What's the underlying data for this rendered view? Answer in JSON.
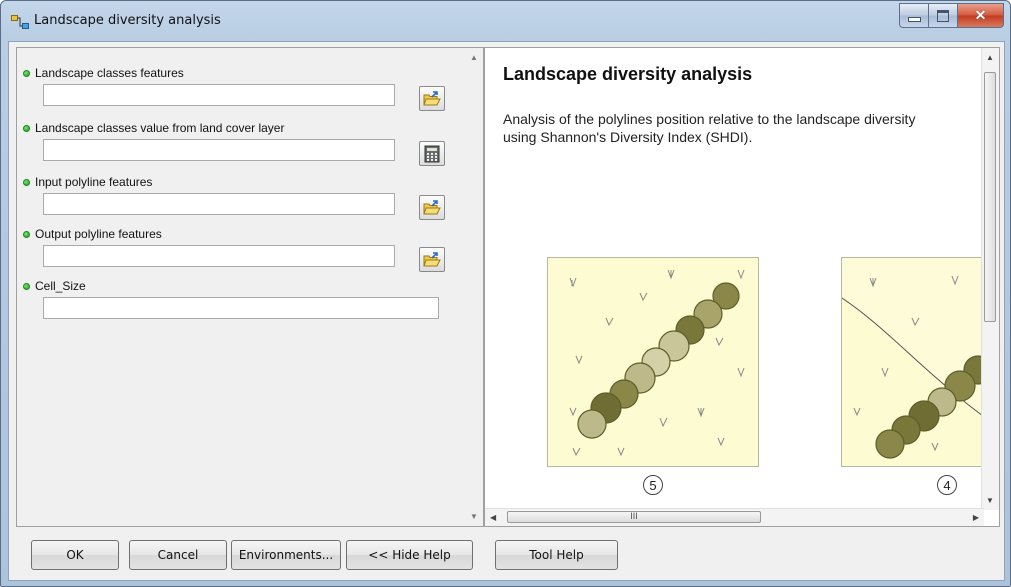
{
  "window": {
    "title": "Landscape diversity analysis"
  },
  "parameters": [
    {
      "label": "Landscape classes features",
      "value": "",
      "button_icon": "folder-open-icon"
    },
    {
      "label": "Landscape classes value from land cover layer",
      "value": "",
      "button_icon": "calculator-icon"
    },
    {
      "label": "Input polyline features",
      "value": "",
      "button_icon": "folder-open-icon"
    },
    {
      "label": "Output polyline features",
      "value": "",
      "button_icon": "folder-open-icon"
    },
    {
      "label": "Cell_Size",
      "value": ""
    }
  ],
  "help": {
    "title": "Landscape diversity analysis",
    "description": "Analysis of the polylines position relative to the landscape diversity using Shannon's Diversity Index (SHDI).",
    "illustrations": [
      {
        "number": "5"
      },
      {
        "number": "4"
      }
    ]
  },
  "buttons": {
    "ok": "OK",
    "cancel": "Cancel",
    "environments": "Environments...",
    "hide_help": "<< Hide Help",
    "tool_help": "Tool Help"
  },
  "scrollbar": {
    "thumb_glyph": "III"
  },
  "colors": {
    "required_dot": "#1e9a1e",
    "illustration_bg": "#fdfbd1",
    "vegetation_dark": "#7a7a3a",
    "vegetation_light": "#c9c69a"
  }
}
